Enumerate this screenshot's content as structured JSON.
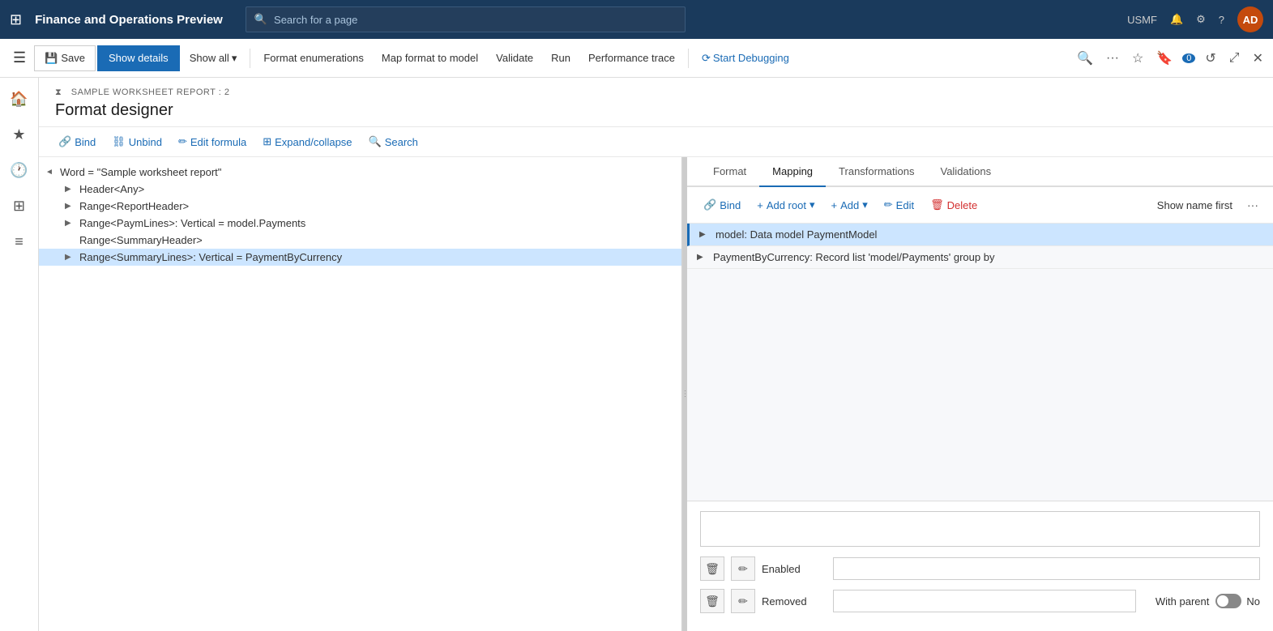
{
  "topNav": {
    "gridIcon": "⊞",
    "appTitle": "Finance and Operations Preview",
    "searchPlaceholder": "Search for a page",
    "userCode": "USMF",
    "userInitials": "AD"
  },
  "actionBar": {
    "saveLabel": "Save",
    "showDetailsLabel": "Show details",
    "showAllLabel": "Show all",
    "formatEnumerationsLabel": "Format enumerations",
    "mapFormatToModelLabel": "Map format to model",
    "validateLabel": "Validate",
    "runLabel": "Run",
    "performanceTraceLabel": "Performance trace",
    "startDebuggingLabel": "Start Debugging"
  },
  "pageHeader": {
    "breadcrumb": "SAMPLE WORKSHEET REPORT : 2",
    "title": "Format designer"
  },
  "toolbar": {
    "bindLabel": "Bind",
    "unbindLabel": "Unbind",
    "editFormulaLabel": "Edit formula",
    "expandCollapseLabel": "Expand/collapse",
    "searchLabel": "Search"
  },
  "treeItems": [
    {
      "level": 0,
      "expand": "◄",
      "text": "Word = \"Sample worksheet report\"",
      "selected": false
    },
    {
      "level": 1,
      "expand": "▶",
      "text": "Header<Any>",
      "selected": false
    },
    {
      "level": 1,
      "expand": "▶",
      "text": "Range<ReportHeader>",
      "selected": false
    },
    {
      "level": 1,
      "expand": "▶",
      "text": "Range<PaymLines>: Vertical = model.Payments",
      "selected": false
    },
    {
      "level": 1,
      "expand": "",
      "text": "Range<SummaryHeader>",
      "selected": false
    },
    {
      "level": 1,
      "expand": "▶",
      "text": "Range<SummaryLines>: Vertical = PaymentByCurrency",
      "selected": true
    }
  ],
  "tabs": [
    {
      "id": "format",
      "label": "Format",
      "active": false
    },
    {
      "id": "mapping",
      "label": "Mapping",
      "active": true
    },
    {
      "id": "transformations",
      "label": "Transformations",
      "active": false
    },
    {
      "id": "validations",
      "label": "Validations",
      "active": false
    }
  ],
  "mappingToolbar": {
    "bindLabel": "Bind",
    "addRootLabel": "Add root",
    "addLabel": "Add",
    "editLabel": "Edit",
    "deleteLabel": "Delete",
    "showNameFirstLabel": "Show name first",
    "moreLabel": "···"
  },
  "modelRows": [
    {
      "expand": "▶",
      "text": "model: Data model PaymentModel",
      "selected": true
    },
    {
      "expand": "▶",
      "text": "PaymentByCurrency: Record list 'model/Payments' group by",
      "selected": false
    }
  ],
  "bottomPanel": {
    "enabledLabel": "Enabled",
    "removedLabel": "Removed",
    "withParentLabel": "With parent",
    "toggleLabel": "No"
  }
}
